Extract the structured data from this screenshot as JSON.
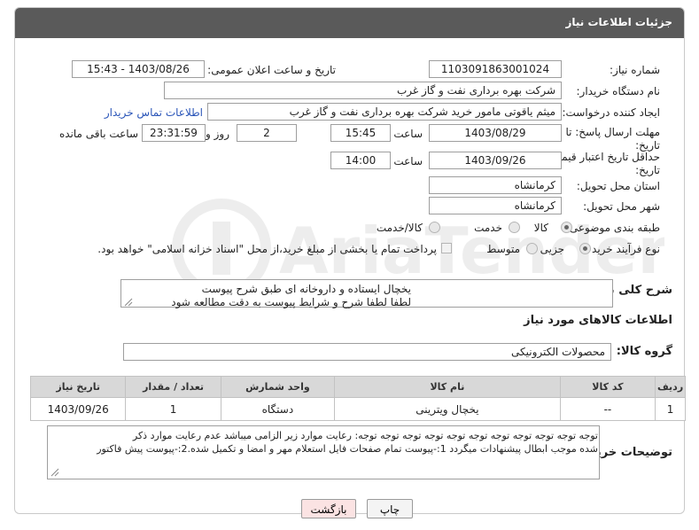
{
  "panel": {
    "title": "جزئیات اطلاعات نیاز"
  },
  "need_number": {
    "label": "شماره نیاز:",
    "value": "1103091863001024"
  },
  "announce": {
    "label": "تاریخ و ساعت اعلان عمومی:",
    "value": "1403/08/26 - 15:43"
  },
  "buyer_org": {
    "label": "نام دستگاه خریدار:",
    "value": "شرکت بهره برداری نفت و گاز غرب"
  },
  "requester": {
    "label": "ایجاد کننده درخواست:",
    "value": "میثم یاقوتی مامور خرید شرکت بهره برداری نفت و گاز غرب",
    "contact_link": "اطلاعات تماس خریدار"
  },
  "reply_deadline": {
    "label_line1": "مهلت ارسال پاسخ: تا",
    "label_line2": "تاریخ:",
    "date": "1403/08/29",
    "time_label": "ساعت",
    "time": "15:45",
    "days": "2",
    "days_label": "روز و",
    "remaining": "23:31:59",
    "remaining_label": "ساعت باقی مانده"
  },
  "price_validity": {
    "label_line1": "حداقل تاریخ اعتبار قیمت: تا",
    "label_line2": "تاریخ:",
    "date": "1403/09/26",
    "time_label": "ساعت",
    "time": "14:00"
  },
  "province": {
    "label": "استان محل تحویل:",
    "value": "کرمانشاه"
  },
  "city": {
    "label": "شهر محل تحویل:",
    "value": "کرمانشاه"
  },
  "category": {
    "label": "طبقه بندی موضوعی:",
    "options": [
      "کالا",
      "خدمت",
      "کالا/خدمت"
    ],
    "selected": 0
  },
  "purchase_type": {
    "label": "نوع فرآیند خرید :",
    "options": [
      "جزیی",
      "متوسط"
    ],
    "selected": 0,
    "treasury_note": "پرداخت تمام یا بخشی از مبلغ خرید،از محل \"اسناد خزانه اسلامی\" خواهد بود."
  },
  "description": {
    "label": "شرح کلی نیاز:",
    "line1": "یخچال ایستاده و داروخانه ای طبق شرح پیوست",
    "line2": "لطفا لطفا شرح و شرایط پیوست به دقت مطالعه شود"
  },
  "goods_info": {
    "heading": "اطلاعات کالاهای مورد نیاز"
  },
  "goods_group": {
    "label": "گروه کالا:",
    "value": "محصولات الکترونیکی"
  },
  "table": {
    "headers": [
      "ردیف",
      "کد کالا",
      "نام کالا",
      "واحد شمارش",
      "تعداد / مقدار",
      "تاریخ نیاز"
    ],
    "rows": [
      [
        "1",
        "--",
        "یخچال ویترینی",
        "دستگاه",
        "1",
        "1403/09/26"
      ]
    ]
  },
  "buyer_notes": {
    "label": "توضیحات خریدار:",
    "line1": "توجه توجه توجه توجه توجه توجه توجه توجه توجه توجه توجه: رعایت موارد زیر الزامی میباشد عدم رعایت موارد ذکر",
    "line2": "شده موجب ابطال پیشنهادات میگردد 1:-پیوست تمام صفحات  فایل استعلام مهر و امضا و تکمیل شده.2:-پیوست پیش فاکتور"
  },
  "buttons": {
    "print": "چاپ",
    "back": "بازگشت"
  },
  "watermark_text": "AriaTender.net",
  "colors": {
    "header_bg": "#5a5a5a",
    "link": "#2a55b8",
    "back_button_bg": "#fbe3e3"
  }
}
